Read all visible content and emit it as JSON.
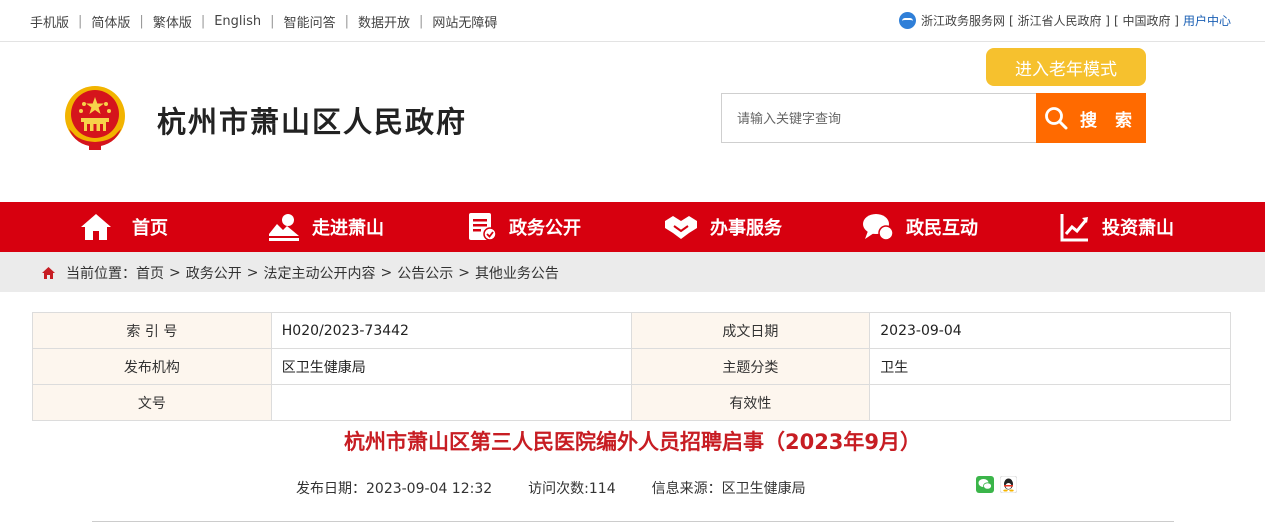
{
  "topbar": {
    "links": [
      "手机版",
      "简体版",
      "繁体版",
      "English",
      "智能问答",
      "数据开放",
      "网站无障碍"
    ],
    "right": {
      "zj_service": "浙江政务服务网",
      "zj_gov": "[ 浙江省人民政府 ]",
      "cn_gov": "[ 中国政府 ]",
      "user_center": "用户中心"
    }
  },
  "header": {
    "site_title": "杭州市萧山区人民政府",
    "elder_mode": "进入老年模式",
    "search": {
      "placeholder": "请输入关键字查询",
      "button": "搜 索"
    }
  },
  "nav": {
    "items": [
      {
        "label": "首页",
        "icon": "home-icon"
      },
      {
        "label": "走进萧山",
        "icon": "landscape-icon"
      },
      {
        "label": "政务公开",
        "icon": "document-check-icon"
      },
      {
        "label": "办事服务",
        "icon": "handshake-icon"
      },
      {
        "label": "政民互动",
        "icon": "chat-bubble-icon"
      },
      {
        "label": "投资萧山",
        "icon": "chart-growth-icon"
      }
    ]
  },
  "breadcrumb": {
    "prefix": "当前位置：",
    "items": [
      "首页",
      "政务公开",
      "法定主动公开内容",
      "公告公示",
      "其他业务公告"
    ]
  },
  "info": {
    "index_label": "索 引 号",
    "index_value": "H020/2023-73442",
    "date_label": "成文日期",
    "date_value": "2023-09-04",
    "org_label": "发布机构",
    "org_value": "区卫生健康局",
    "topic_label": "主题分类",
    "topic_value": "卫生",
    "doc_label": "文号",
    "doc_value": "",
    "valid_label": "有效性",
    "valid_value": ""
  },
  "article": {
    "title": "杭州市萧山区第三人民医院编外人员招聘启事（2023年9月）",
    "publish": "发布日期：2023-09-04 12:32",
    "visits": "访问次数:114",
    "source": "信息来源：区卫生健康局"
  },
  "colors": {
    "nav_red": "#d7000f",
    "search_orange": "#ff6a00",
    "elder_yellow": "#f6c12e",
    "title_red": "#c71d23"
  }
}
